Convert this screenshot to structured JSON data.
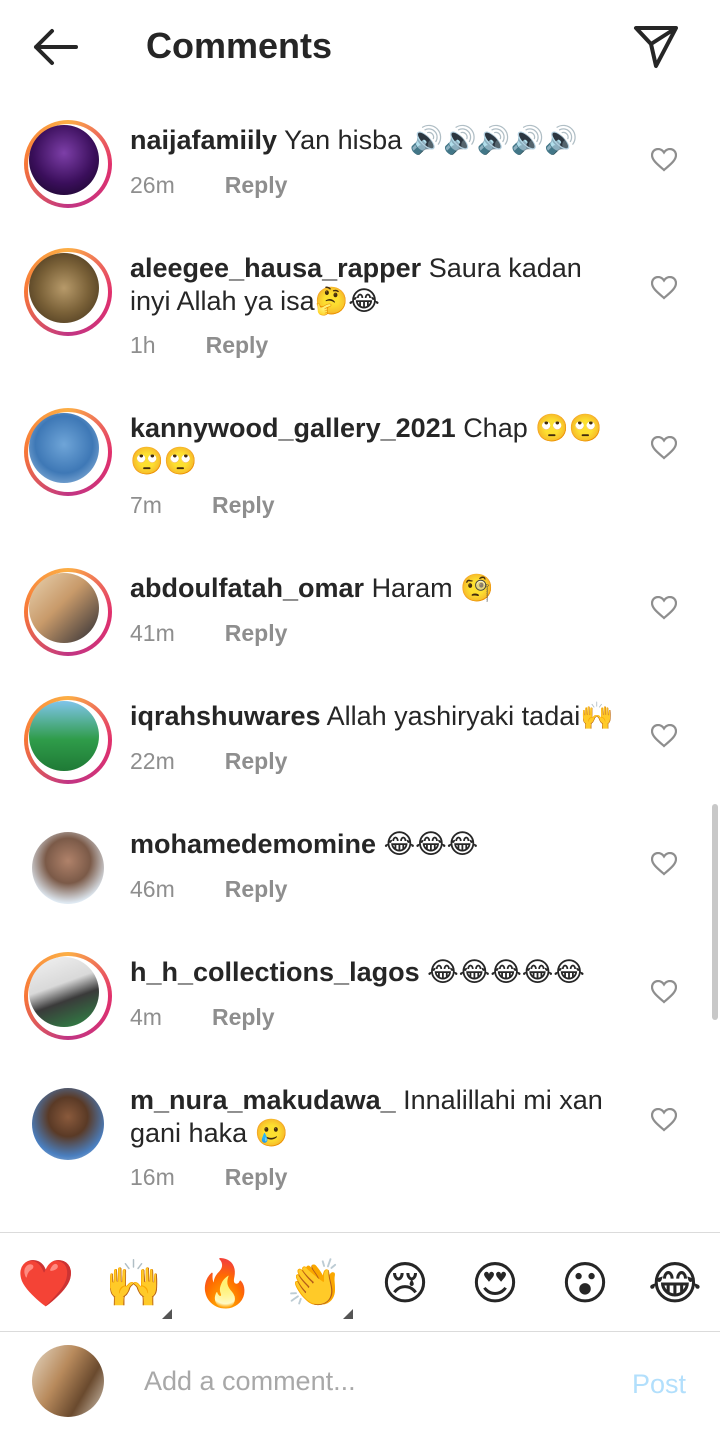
{
  "header": {
    "title": "Comments",
    "back_icon": "arrow-left-icon",
    "share_icon": "paper-plane-icon"
  },
  "comments": [
    {
      "username": "naijafamiily",
      "text": "Yan hisba 🔊🔊🔊🔊🔊",
      "time": "26m",
      "reply": "Reply"
    },
    {
      "username": "aleegee_hausa_rapper",
      "text": "Saura kadan inyi Allah ya isa🤔😂",
      "time": "1h",
      "reply": "Reply"
    },
    {
      "username": "kannywood_gallery_2021",
      "text": "Chap 🙄🙄🙄🙄",
      "time": "7m",
      "reply": "Reply"
    },
    {
      "username": "abdoulfatah_omar",
      "text": "Haram 🧐",
      "time": "41m",
      "reply": "Reply"
    },
    {
      "username": "iqrahshuwares",
      "text": "Allah yashiryaki tadai🙌",
      "time": "22m",
      "reply": "Reply"
    },
    {
      "username": "mohamedemomine",
      "text": "😂😂😂",
      "time": "46m",
      "reply": "Reply"
    },
    {
      "username": "h_h_collections_lagos",
      "text": "😂😂😂😂😂",
      "time": "4m",
      "reply": "Reply"
    },
    {
      "username": "m_nura_makudawa_",
      "text": "Innalillahi mi xan gani haka 🥲",
      "time": "16m",
      "reply": "Reply"
    }
  ],
  "reactions": [
    "❤️",
    "🙌",
    "🔥",
    "👏",
    "😢",
    "😍",
    "😮",
    "😂"
  ],
  "composer": {
    "placeholder": "Add a comment...",
    "post_label": "Post"
  },
  "colors": {
    "text": "#262626",
    "secondary": "#8e8e8e",
    "post_disabled": "#b2dffc",
    "divider": "#dbdbdb"
  }
}
